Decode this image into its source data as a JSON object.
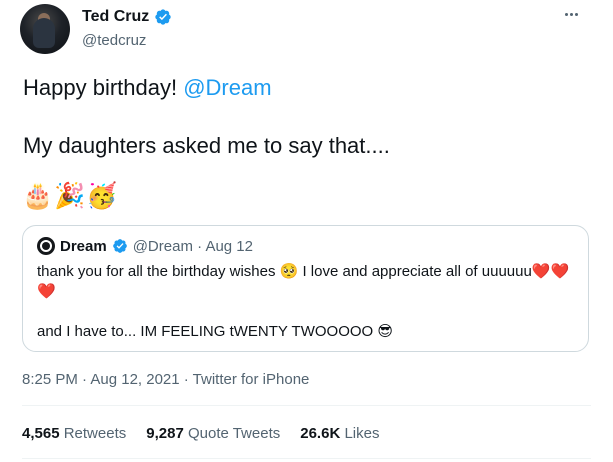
{
  "author": {
    "name": "Ted Cruz",
    "handle": "@tedcruz"
  },
  "tweet": {
    "line1_text": "Happy birthday! ",
    "line1_mention": "@Dream",
    "line2": "My daughters asked me to say that....",
    "emojis": "🎂🎉🥳"
  },
  "quote": {
    "name": "Dream",
    "handle_date": "@Dream · Aug 12",
    "text1": "thank you for all the birthday wishes 🥺 I love and appreciate all of uuuuuu",
    "hearts": "❤️❤️❤️",
    "text2": "and I have to... IM FEELING tWENTY TWOOOOO 😎"
  },
  "meta": {
    "time_date": "8:25 PM · Aug 12, 2021 · ",
    "client": "Twitter for iPhone"
  },
  "stats": {
    "retweets_count": "4,565",
    "retweets_label": "Retweets",
    "quotes_count": "9,287",
    "quotes_label": "Quote Tweets",
    "likes_count": "26.6K",
    "likes_label": "Likes"
  },
  "colors": {
    "accent": "#1d9bf0",
    "secondary_text": "#536471",
    "heart": "#e0245e"
  },
  "icons": [
    "verified-badge-icon",
    "more-options-icon"
  ]
}
